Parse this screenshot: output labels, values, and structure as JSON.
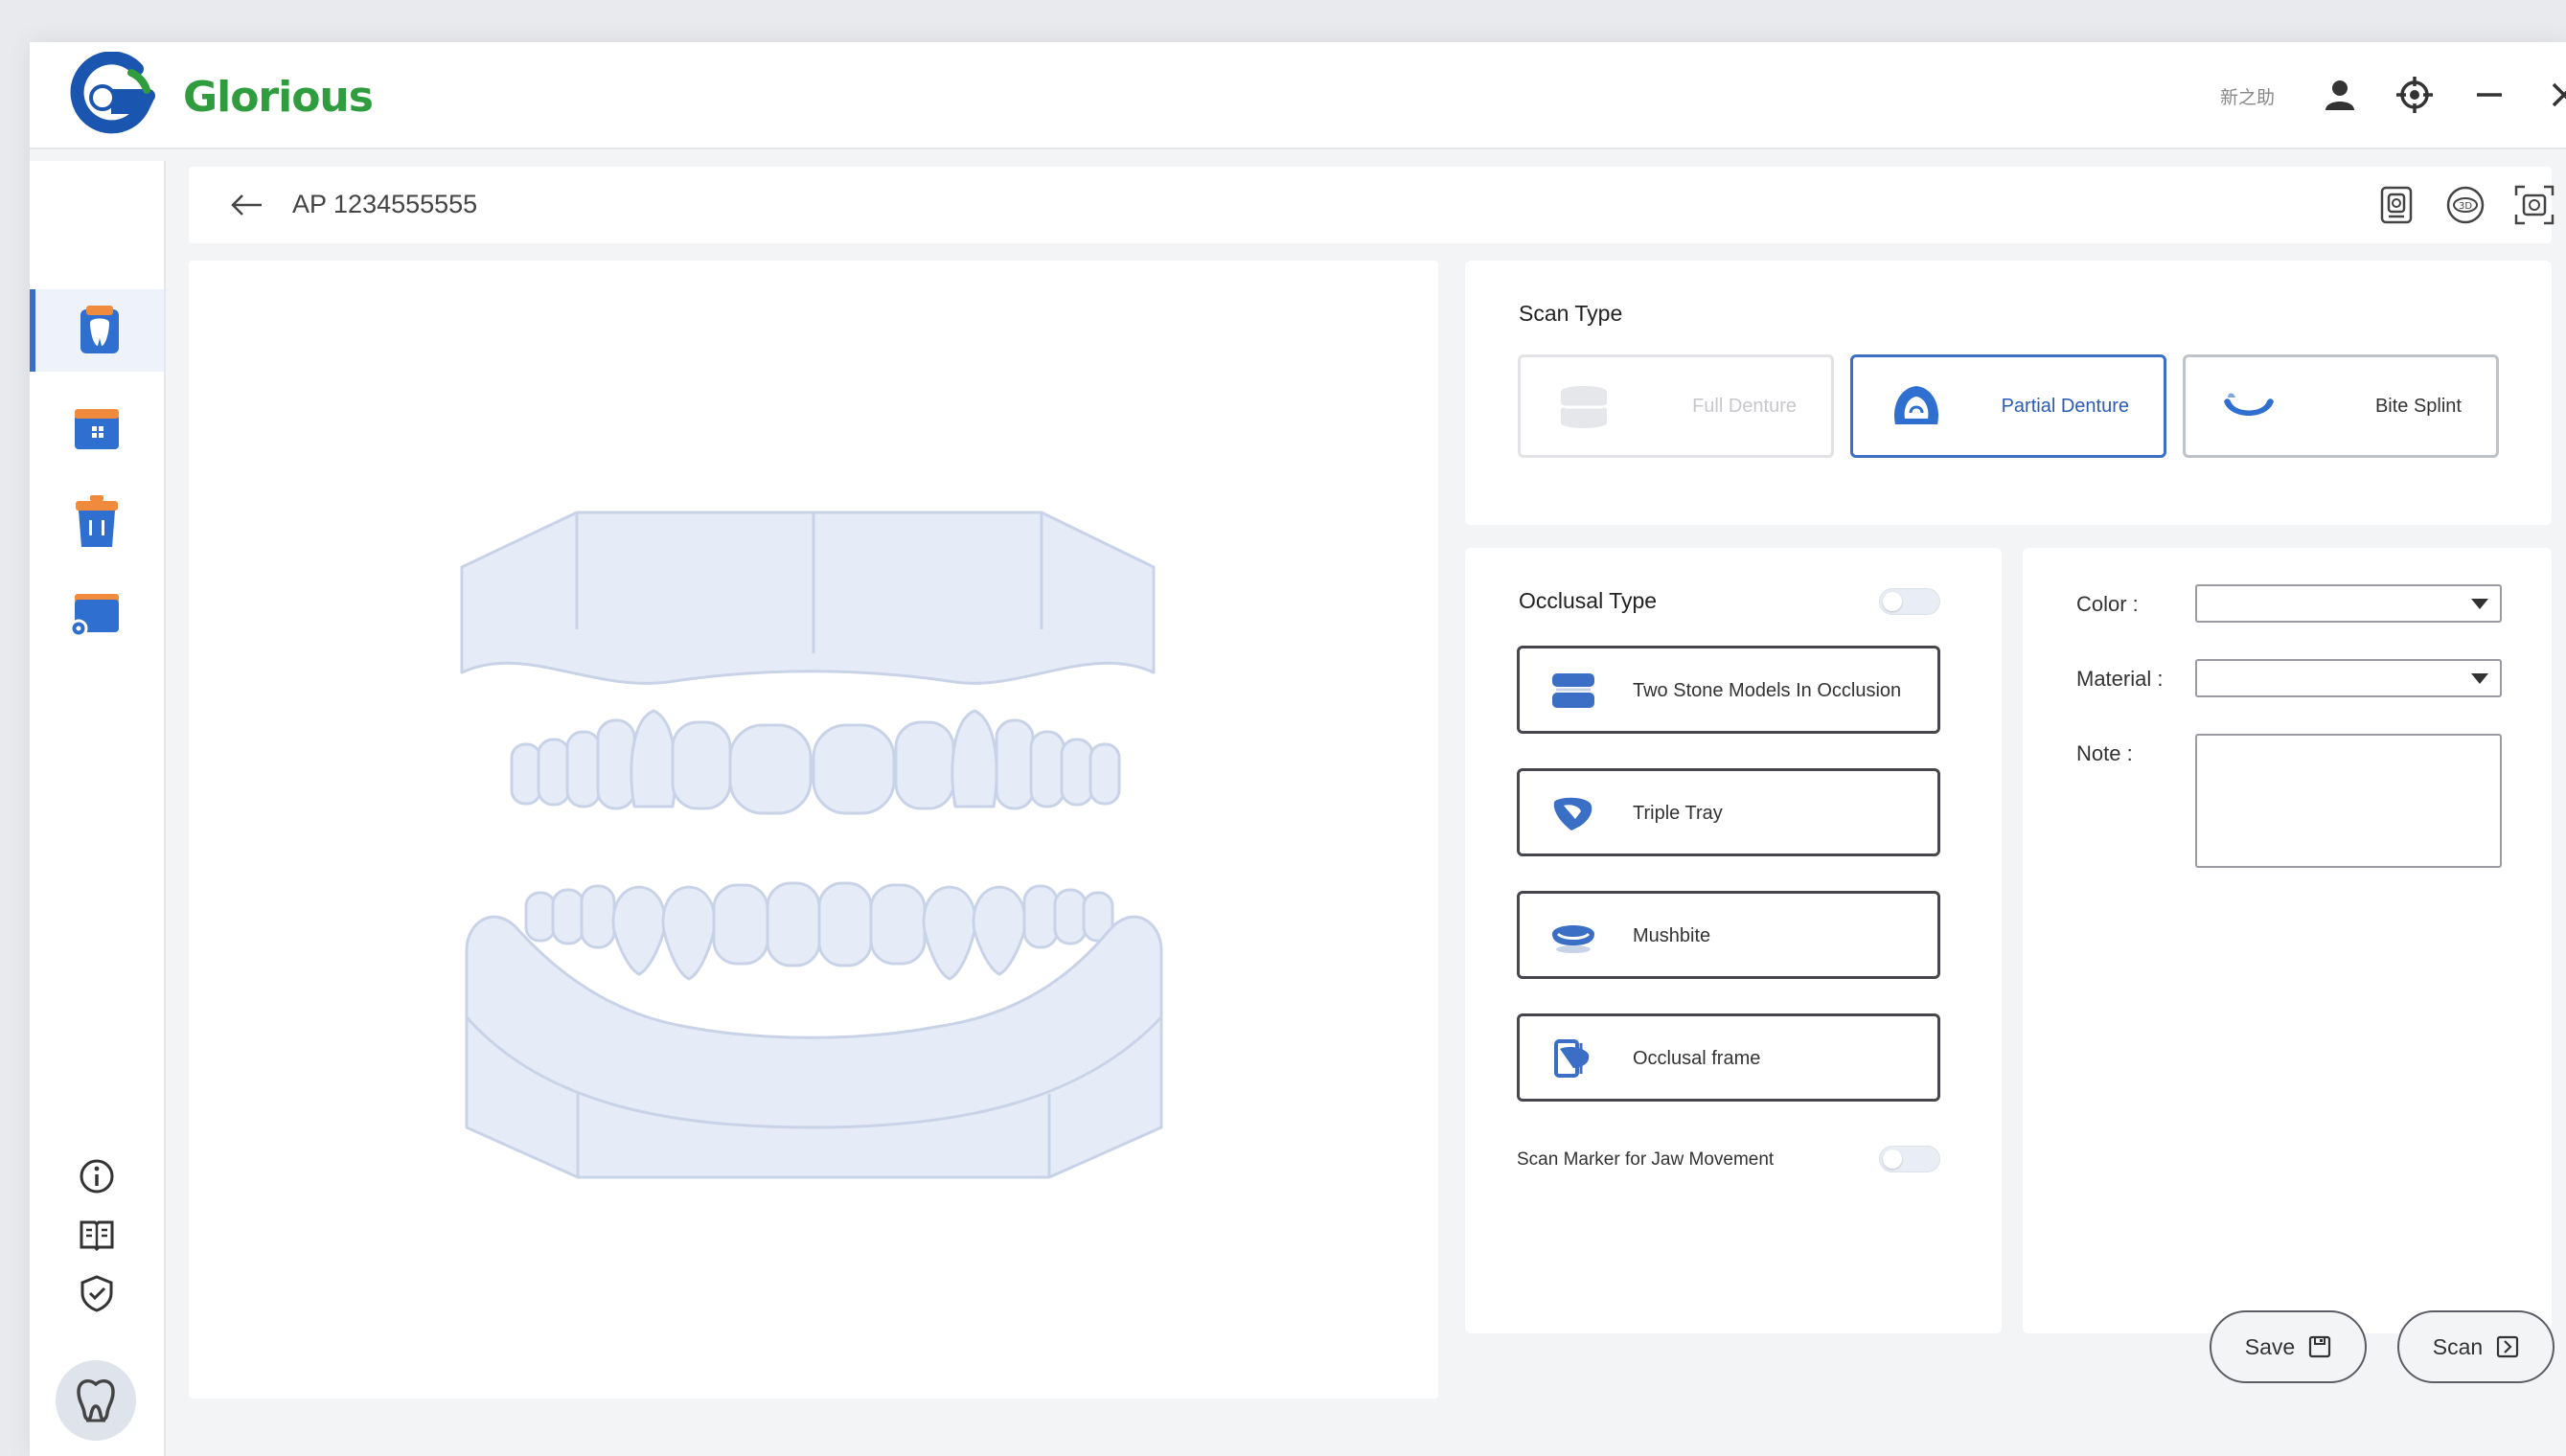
{
  "app": {
    "brand": "Glorious",
    "user_label": "新之助"
  },
  "addressbar": {
    "case_id": "AP  1234555555"
  },
  "scan_type": {
    "title": "Scan Type",
    "options": [
      {
        "label": "Full Denture",
        "state": "disabled",
        "icon": "full-denture-icon"
      },
      {
        "label": "Partial Denture",
        "state": "selected",
        "icon": "partial-denture-icon"
      },
      {
        "label": "Bite Splint",
        "state": "normal",
        "icon": "bite-splint-icon"
      }
    ]
  },
  "occlusal": {
    "title": "Occlusal Type",
    "toggle_on": false,
    "options": [
      {
        "label": "Two Stone Models In Occlusion",
        "icon": "stone-models-icon"
      },
      {
        "label": "Triple Tray",
        "icon": "triple-tray-icon"
      },
      {
        "label": "Mushbite",
        "icon": "mushbite-icon"
      },
      {
        "label": "Occlusal frame",
        "icon": "occlusal-frame-icon"
      }
    ],
    "jaw_marker_label": "Scan Marker for Jaw Movement",
    "jaw_marker_on": false
  },
  "form": {
    "color_label": "Color :",
    "color_value": "",
    "material_label": "Material :",
    "material_value": "",
    "note_label": "Note :",
    "note_value": ""
  },
  "actions": {
    "save_label": "Save",
    "scan_label": "Scan"
  },
  "colors": {
    "accent": "#3b6fc6",
    "brand_green": "#2f9c3d",
    "brand_blue": "#1a56b0",
    "tooth_fill": "#e6ecf7",
    "tooth_stroke": "#c9d3e8"
  }
}
